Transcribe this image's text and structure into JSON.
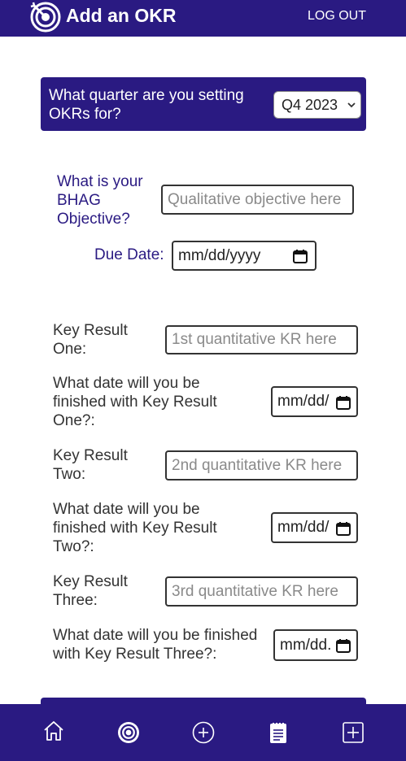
{
  "header": {
    "title": "Add an OKR",
    "logout_label": "LOG OUT",
    "logo_icon": "target-icon"
  },
  "quarter": {
    "question": "What quarter are you setting OKRs for?",
    "selected": "Q4 2023"
  },
  "objective": {
    "label": "What is your BHAG Objective?",
    "placeholder": "Qualitative objective here",
    "due_label": "Due Date:",
    "date_value": "mm/dd/yyyy"
  },
  "key_results": [
    {
      "label": "Key Result One:",
      "placeholder": "1st quantitative KR here",
      "date_label": "What date will you be finished with Key Result One?:",
      "date_value": "mm/dd/"
    },
    {
      "label": "Key Result Two:",
      "placeholder": "2nd quantitative KR here",
      "date_label": "What date will you be finished with Key Result Two?:",
      "date_value": "mm/dd/"
    },
    {
      "label": "Key Result Three:",
      "placeholder": "3rd quantitative KR here",
      "date_label": "What date will you be finished with Key Result Three?:",
      "date_value": "mm/dd."
    }
  ],
  "nav": {
    "items": [
      "home-icon",
      "target-icon",
      "plus-circle-icon",
      "notepad-icon",
      "plus-square-icon"
    ]
  },
  "colors": {
    "brand": "#2a1a82",
    "text": "#333333",
    "placeholder": "#8a8a8a"
  }
}
